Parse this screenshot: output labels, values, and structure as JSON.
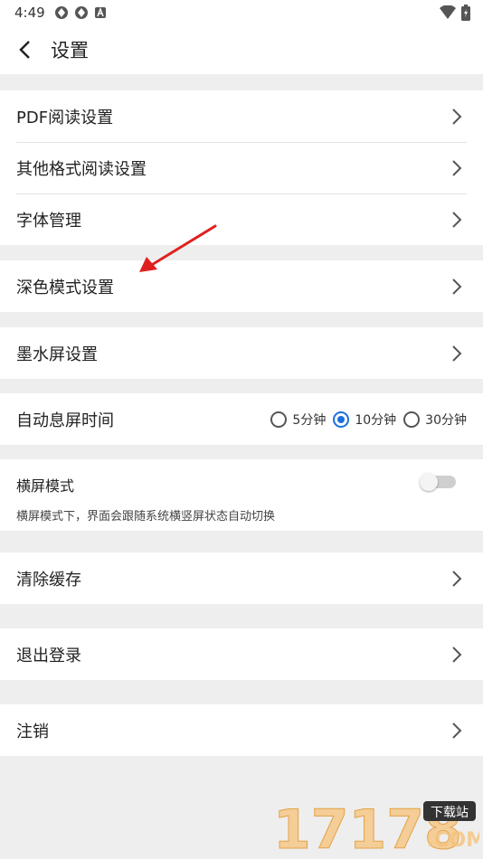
{
  "status_bar": {
    "time": "4:49"
  },
  "header": {
    "title": "设置"
  },
  "group1": {
    "items": [
      {
        "label": "PDF阅读设置"
      },
      {
        "label": "其他格式阅读设置"
      },
      {
        "label": "字体管理"
      }
    ]
  },
  "dark_mode": {
    "label": "深色模式设置"
  },
  "eink": {
    "label": "墨水屏设置"
  },
  "screen_timeout": {
    "label": "自动息屏时间",
    "options": [
      {
        "label": "5分钟",
        "selected": false
      },
      {
        "label": "10分钟",
        "selected": true
      },
      {
        "label": "30分钟",
        "selected": false
      }
    ]
  },
  "landscape": {
    "title": "横屏模式",
    "description": "横屏模式下，界面会跟随系统横竖屏状态自动切换",
    "enabled": false
  },
  "clear_cache": {
    "label": "清除缓存"
  },
  "logout": {
    "label": "退出登录"
  },
  "deregister": {
    "label": "注销"
  },
  "watermark": {
    "text": "17178",
    "sub": "下载站",
    "domain": ".COM"
  },
  "colors": {
    "accent": "#1a6fe0",
    "arrow": "#e02020",
    "background": "#eeeeee"
  }
}
